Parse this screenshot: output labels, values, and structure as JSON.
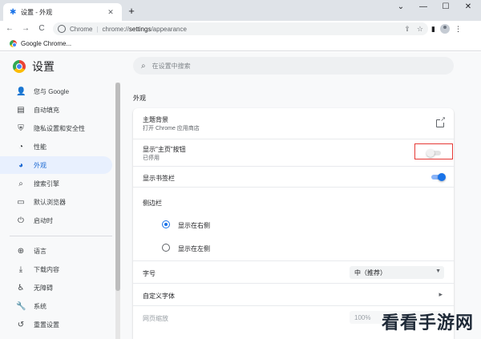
{
  "window": {
    "tab_title": "设置 - 外观",
    "tab_close": "✕",
    "new_tab": "+",
    "controls": {
      "chevron": "⌄",
      "minimize": "—",
      "maximize": "☐",
      "close": "✕"
    }
  },
  "toolbar": {
    "back": "←",
    "forward": "→",
    "reload": "C",
    "host": "Chrome",
    "url_prefix": "chrome://",
    "url_path_bold": "settings",
    "url_suffix": "/appearance"
  },
  "bookmarks": {
    "items": [
      {
        "label": "Google Chrome..."
      }
    ]
  },
  "settings": {
    "title": "设置",
    "search_placeholder": "在设置中搜索",
    "nav": [
      {
        "label": "您与 Google",
        "icon": "person-icon",
        "glyph": "👤"
      },
      {
        "label": "自动填充",
        "icon": "autofill-icon",
        "glyph": "▤"
      },
      {
        "label": "隐私设置和安全性",
        "icon": "shield-icon",
        "glyph": "⛨"
      },
      {
        "label": "性能",
        "icon": "speed-icon",
        "glyph": "◔"
      },
      {
        "label": "外观",
        "icon": "palette-icon",
        "glyph": "◕",
        "active": true
      },
      {
        "label": "搜索引擎",
        "icon": "search-icon",
        "glyph": "⌕"
      },
      {
        "label": "默认浏览器",
        "icon": "browser-icon",
        "glyph": "▭"
      },
      {
        "label": "启动时",
        "icon": "power-icon",
        "glyph": "⏻"
      },
      {
        "label": "语言",
        "icon": "globe-icon",
        "glyph": "⊕"
      },
      {
        "label": "下载内容",
        "icon": "download-icon",
        "glyph": "⤓"
      },
      {
        "label": "无障碍",
        "icon": "accessibility-icon",
        "glyph": "♿"
      },
      {
        "label": "系统",
        "icon": "wrench-icon",
        "glyph": "🔧"
      },
      {
        "label": "重置设置",
        "icon": "reset-icon",
        "glyph": "↺"
      }
    ],
    "section_title": "外观",
    "appearance": {
      "theme": {
        "label": "主题背景",
        "sub": "打开 Chrome 应用商店"
      },
      "home_button": {
        "label": "显示\"主页\"按钮",
        "sub": "已停用",
        "enabled": false
      },
      "bookmarks_bar": {
        "label": "显示书签栏",
        "enabled": true
      },
      "side_panel": {
        "label": "侧边栏",
        "options": [
          {
            "label": "显示在右侧",
            "checked": true
          },
          {
            "label": "显示在左侧",
            "checked": false
          }
        ]
      },
      "font_size": {
        "label": "字号",
        "value": "中（推荐）"
      },
      "custom_fonts": {
        "label": "自定义字体"
      },
      "page_zoom": {
        "label": "网页缩放",
        "value": "100%"
      }
    }
  },
  "watermark": "看看手游网",
  "colors": {
    "accent": "#1a73e8",
    "highlight_box": "#e53935",
    "active_nav_bg": "#e8f0fe"
  }
}
